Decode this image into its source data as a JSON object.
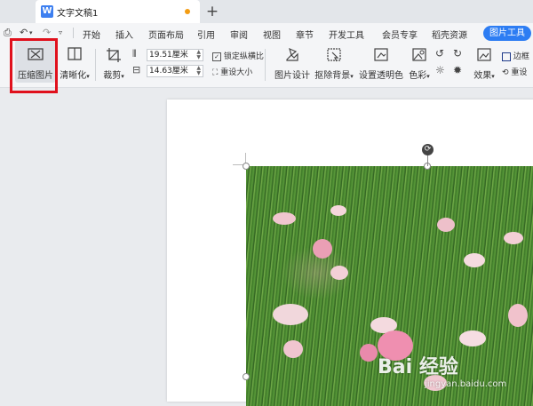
{
  "titlebar": {
    "doc_title": "文字文稿1",
    "new_tab": "+"
  },
  "menubar": {
    "items": [
      "开始",
      "插入",
      "页面布局",
      "引用",
      "审阅",
      "视图",
      "章节",
      "开发工具",
      "会员专享",
      "稻壳资源"
    ],
    "picture_tools": "图片工具"
  },
  "ribbon": {
    "compress": "压缩图片",
    "clarity": "清晰化",
    "crop": "裁剪",
    "width": "19.51厘米",
    "height": "14.63厘米",
    "lock_ratio": "锁定纵横比",
    "reset_size": "重设大小",
    "picture_design": "图片设计",
    "remove_bg": "抠除背景",
    "set_transparent": "设置透明色",
    "color": "色彩",
    "effects": "效果",
    "border": "边框",
    "reset": "重设"
  },
  "watermark": {
    "main": "Bai 经验",
    "sub": "jingyan.baidu.com"
  }
}
